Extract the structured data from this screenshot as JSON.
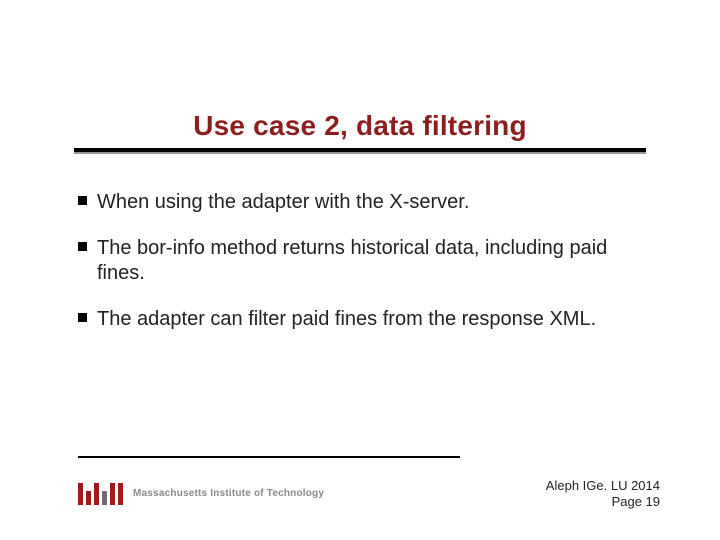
{
  "title": "Use case 2, data filtering",
  "bullets": [
    "When using the adapter with the X-server.",
    "The bor-info method returns historical data, including paid fines.",
    "The adapter can filter paid fines from the response XML."
  ],
  "institution": "Massachusetts Institute of Technology",
  "footer": {
    "line1": "Aleph  IGe. LU 2014",
    "line2": "Page 19"
  }
}
